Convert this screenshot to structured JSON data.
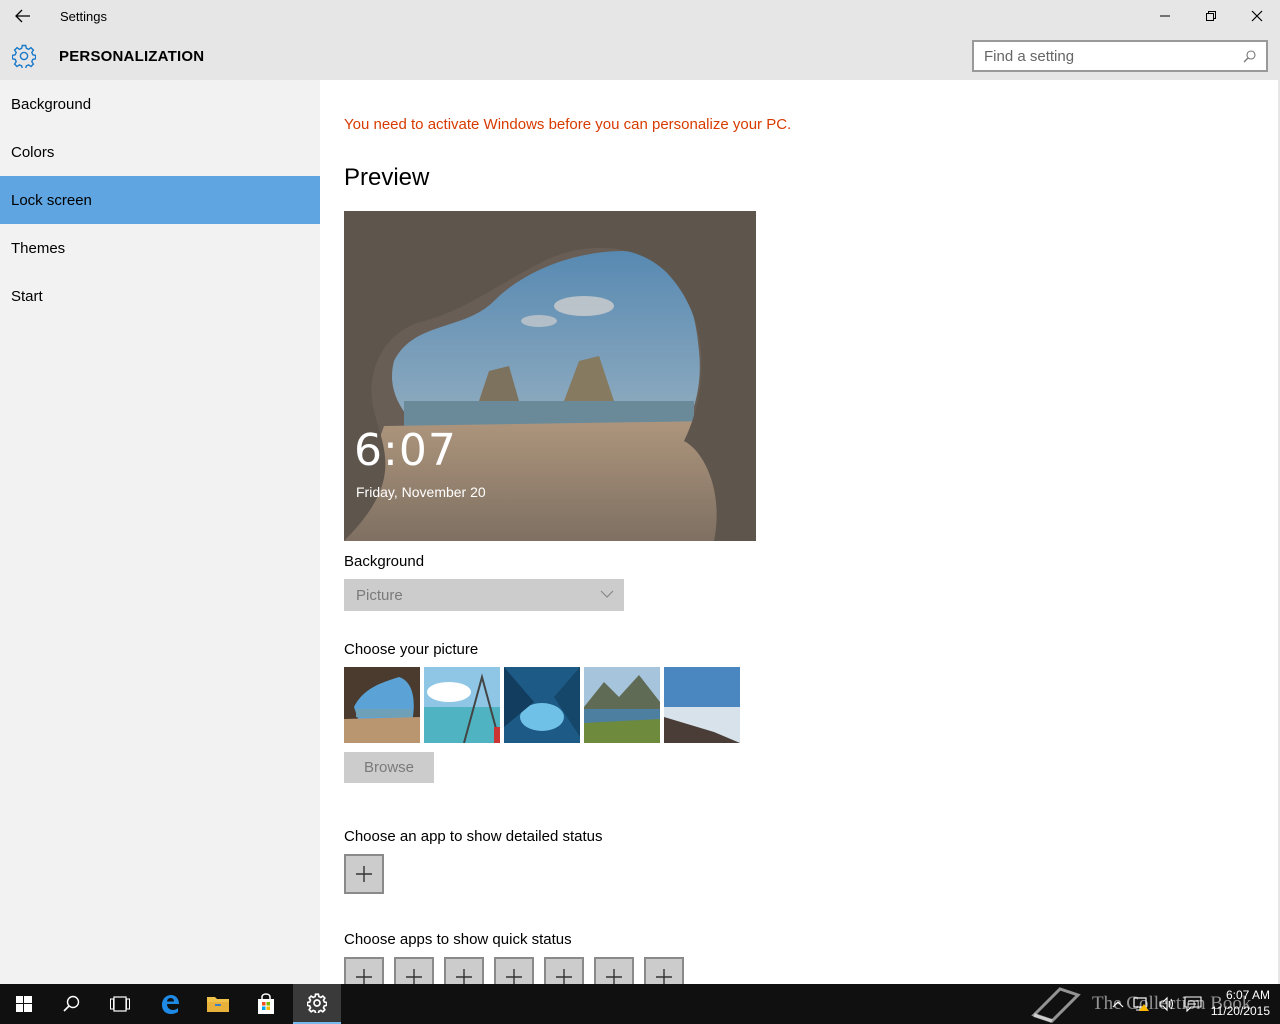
{
  "window": {
    "title": "Settings"
  },
  "header": {
    "section_title": "PERSONALIZATION",
    "search_placeholder": "Find a setting"
  },
  "sidebar": {
    "items": [
      {
        "label": "Background",
        "selected": false
      },
      {
        "label": "Colors",
        "selected": false
      },
      {
        "label": "Lock screen",
        "selected": true
      },
      {
        "label": "Themes",
        "selected": false
      },
      {
        "label": "Start",
        "selected": false
      }
    ]
  },
  "main": {
    "activation_message": "You need to activate Windows before you can personalize your PC.",
    "preview_heading": "Preview",
    "preview_time": "6:07",
    "preview_date": "Friday, November 20",
    "background_label": "Background",
    "background_value": "Picture",
    "choose_picture_label": "Choose your picture",
    "browse_label": "Browse",
    "detailed_status_label": "Choose an app to show detailed status",
    "quick_status_label": "Choose apps to show quick status"
  },
  "taskbar": {
    "watermark": "The Collection Book",
    "clock_time": "6:07 AM",
    "clock_date": "11/20/2015"
  },
  "colors": {
    "accent": "#5ea5e2",
    "warning": "#d83b01",
    "titlebar": "#e6e6e6",
    "sidebar": "#f2f2f2",
    "taskbar": "#101010"
  }
}
